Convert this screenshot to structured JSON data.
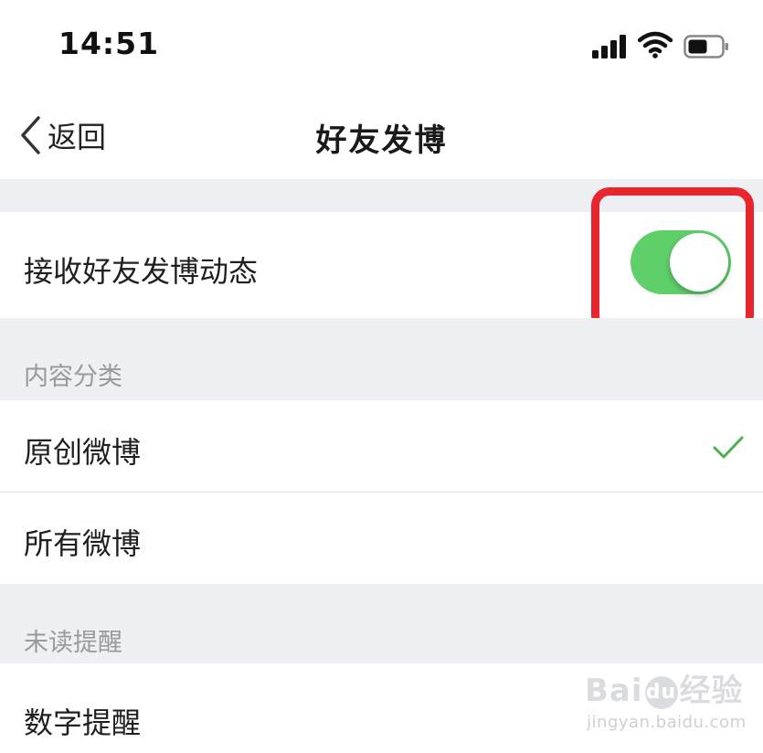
{
  "status_bar": {
    "time": "14:51",
    "icons": [
      "cellular-signal-icon",
      "wifi-icon",
      "battery-icon"
    ]
  },
  "nav": {
    "back_label": "返回",
    "title": "好友发博"
  },
  "settings": {
    "receive_updates": {
      "label": "接收好友发博动态",
      "toggle_on": true,
      "toggle_color": "#5fcf6a"
    }
  },
  "sections": {
    "content_category": {
      "header": "内容分类",
      "options": [
        {
          "label": "原创微博",
          "selected": true
        },
        {
          "label": "所有微博",
          "selected": false
        }
      ]
    },
    "unread_reminder": {
      "header": "未读提醒",
      "options": [
        {
          "label": "数字提醒"
        }
      ]
    }
  },
  "annotation": {
    "highlight_color": "#e8262d"
  },
  "check_color": "#4caf50",
  "watermark": {
    "brand_left": "Bai",
    "brand_right": "经验",
    "url": "jingyan.baidu.com"
  }
}
